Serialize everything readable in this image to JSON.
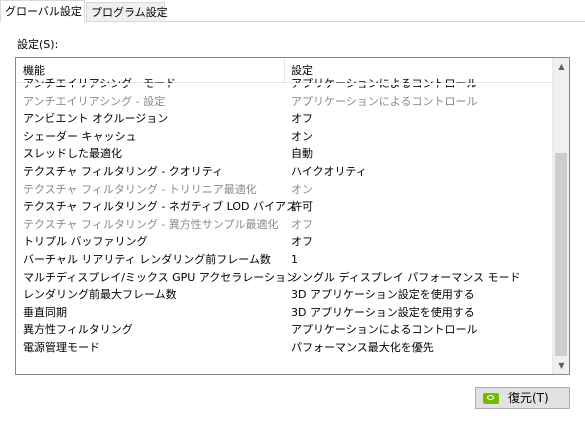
{
  "tabs": {
    "global": "グローバル設定",
    "program": "プログラム設定"
  },
  "settings_label": "設定(S):",
  "table": {
    "columns": {
      "feature": "機能",
      "setting": "設定"
    },
    "rows": [
      {
        "feature": "アンチエイリアシング - モード",
        "value": "アプリケーションによるコントロール",
        "enabled": true
      },
      {
        "feature": "アンチエイリアシング - 設定",
        "value": "アプリケーションによるコントロール",
        "enabled": false
      },
      {
        "feature": "アンビエント オクルージョン",
        "value": "オフ",
        "enabled": true
      },
      {
        "feature": "シェーダー キャッシュ",
        "value": "オン",
        "enabled": true
      },
      {
        "feature": "スレッドした最適化",
        "value": "自動",
        "enabled": true
      },
      {
        "feature": "テクスチャ フィルタリング - クオリティ",
        "value": "ハイクオリティ",
        "enabled": true
      },
      {
        "feature": "テクスチャ フィルタリング - トリリニア最適化",
        "value": "オン",
        "enabled": false
      },
      {
        "feature": "テクスチャ フィルタリング - ネガティブ LOD バイアス",
        "value": "許可",
        "enabled": true
      },
      {
        "feature": "テクスチャ フィルタリング - 異方性サンプル最適化",
        "value": "オフ",
        "enabled": false
      },
      {
        "feature": "トリプル バッファリング",
        "value": "オフ",
        "enabled": true
      },
      {
        "feature": "バーチャル リアリティ レンダリング前フレーム数",
        "value": "1",
        "enabled": true
      },
      {
        "feature": "マルチディスプレイ/ミックス GPU アクセラレーション",
        "value": "シングル ディスプレイ パフォーマンス モード",
        "enabled": true
      },
      {
        "feature": "レンダリング前最大フレーム数",
        "value": "3D アプリケーション設定を使用する",
        "enabled": true
      },
      {
        "feature": "垂直同期",
        "value": "3D アプリケーション設定を使用する",
        "enabled": true
      },
      {
        "feature": "異方性フィルタリング",
        "value": "アプリケーションによるコントロール",
        "enabled": true
      },
      {
        "feature": "電源管理モード",
        "value": "パフォーマンス最大化を優先",
        "enabled": true
      }
    ]
  },
  "scrollbar": {
    "up_icon": "▲",
    "down_icon": "▼",
    "position": "bottom"
  },
  "restore_button": {
    "label": "復元(T)",
    "icon": "nvidia-logo-icon"
  },
  "colors": {
    "disabled_text": "#8a8a8a",
    "nvidia_green": "#76b900"
  }
}
